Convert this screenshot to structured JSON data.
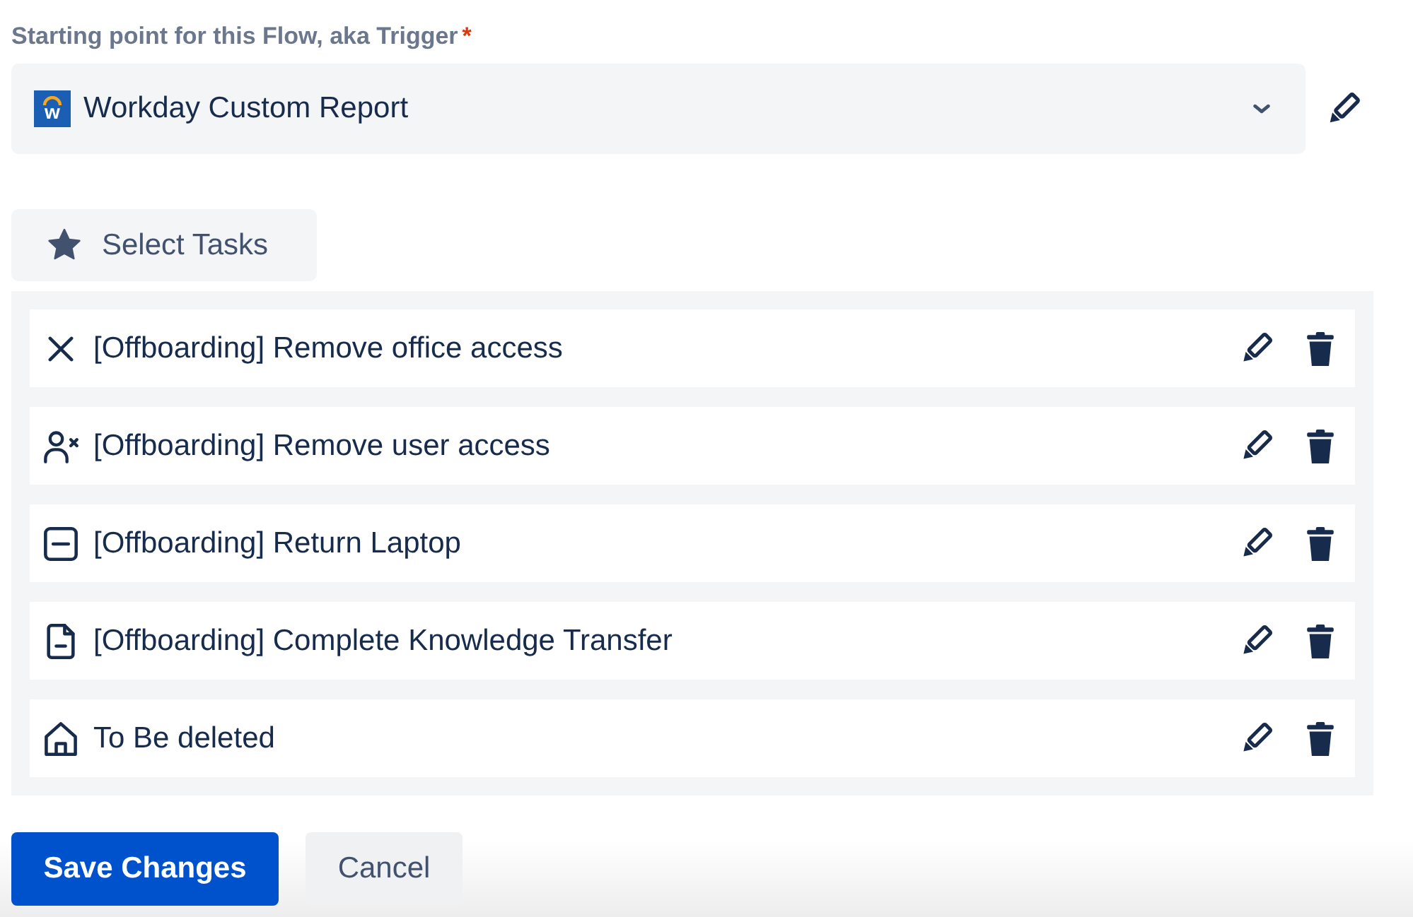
{
  "trigger": {
    "label": "Starting point for this Flow, aka Trigger",
    "required_mark": "*",
    "logo_letter": "w",
    "value": "Workday Custom Report"
  },
  "select_tasks_button": {
    "label": "Select Tasks"
  },
  "tasks": [
    {
      "kind": "cross",
      "title": "[Offboarding] Remove office access"
    },
    {
      "kind": "person-cross",
      "title": "[Offboarding] Remove user access"
    },
    {
      "kind": "minus-square",
      "title": "[Offboarding] Return Laptop"
    },
    {
      "kind": "document",
      "title": "[Offboarding] Complete Knowledge Transfer"
    },
    {
      "kind": "house",
      "title": "To Be deleted"
    }
  ],
  "buttons": [
    {
      "kind": "save",
      "label": "Save Changes"
    },
    {
      "kind": "cancel",
      "label": "Cancel"
    }
  ]
}
